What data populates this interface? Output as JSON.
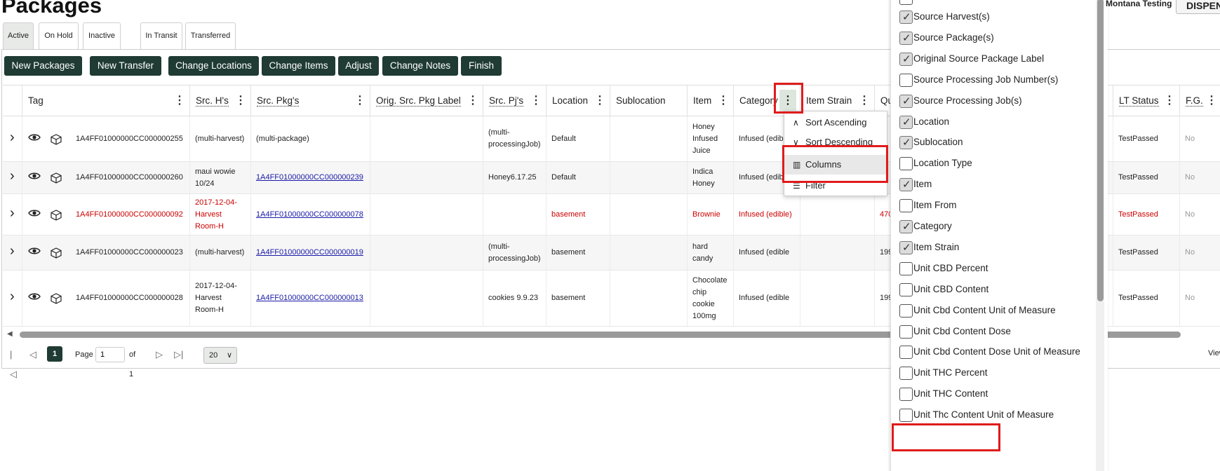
{
  "page": {
    "title": "Packages",
    "facility": "Montana Testing",
    "dispense_label": "DISPENSE"
  },
  "tabs": [
    {
      "label": "Active",
      "active": true
    },
    {
      "label": "On Hold"
    },
    {
      "label": "Inactive"
    },
    {
      "label": "In Transit"
    },
    {
      "label": "Transferred"
    }
  ],
  "toolbar": [
    "New Packages",
    "New Transfer",
    "Change Locations",
    "Change Items",
    "Adjust",
    "Change Notes",
    "Finish"
  ],
  "columns": [
    "Tag",
    "Src. H's",
    "Src. Pkg's",
    "Orig. Src. Pkg Label",
    "Src. Pj's",
    "Location",
    "Sublocation",
    "Item",
    "Category",
    "Item Strain",
    "Qu",
    "LT Status",
    "F.G."
  ],
  "rows": [
    {
      "tag": "1A4FF01000000CC000000255",
      "src_h": [
        "(multi-harvest)"
      ],
      "src_pkg": "(multi-package)",
      "src_pkg_link": false,
      "src_pj": [
        "(multi-",
        "processingJob)"
      ],
      "location": "Default",
      "item": [
        "Honey",
        "Infused",
        "Juice"
      ],
      "category": "Infused (edible",
      "qty": "",
      "lt": "TestPassed",
      "fg": "No",
      "red": false
    },
    {
      "tag": "1A4FF01000000CC000000260",
      "src_h": [
        "maui wowie",
        "10/24"
      ],
      "src_pkg": "1A4FF01000000CC000000239",
      "src_pkg_link": true,
      "src_pj": [
        "Honey6.17.25"
      ],
      "location": "Default",
      "item": [
        "Indica",
        "Honey"
      ],
      "category": "Infused (edib",
      "qty": "",
      "lt": "TestPassed",
      "fg": "No",
      "red": false
    },
    {
      "tag": "1A4FF01000000CC000000092",
      "src_h": [
        "2017-12-04-",
        "Harvest",
        "Room-H"
      ],
      "src_pkg": "1A4FF01000000CC000000078",
      "src_pkg_link": true,
      "src_pj": [],
      "location": "basement",
      "item": [
        "Brownie"
      ],
      "category": "Infused (edible)",
      "qty": "470",
      "lt": "TestPassed",
      "fg": "No",
      "red": true
    },
    {
      "tag": "1A4FF01000000CC000000023",
      "src_h": [
        "(multi-harvest)"
      ],
      "src_pkg": "1A4FF01000000CC000000019",
      "src_pkg_link": true,
      "src_pj": [
        "(multi-",
        "processingJob)"
      ],
      "location": "basement",
      "item": [
        "hard",
        "candy"
      ],
      "category": "Infused (edible",
      "qty": "199",
      "lt": "TestPassed",
      "fg": "No",
      "red": false
    },
    {
      "tag": "1A4FF01000000CC000000028",
      "src_h": [
        "2017-12-04-",
        "Harvest",
        "Room-H"
      ],
      "src_pkg": "1A4FF01000000CC000000013",
      "src_pkg_link": true,
      "src_pj": [
        "cookies 9.9.23"
      ],
      "location": "basement",
      "item": [
        "Chocolate",
        "chip",
        "cookie",
        "100mg"
      ],
      "category": "Infused (edible",
      "qty": "199",
      "lt": "TestPassed",
      "fg": "No",
      "red": false
    }
  ],
  "pager": {
    "current": "1",
    "page_label": "Page",
    "page_value": "1",
    "of_label": "of 1",
    "page_size": "20",
    "view_label": "View"
  },
  "column_menu": [
    "Sort Ascending",
    "Sort Descending",
    "Columns",
    "Filter"
  ],
  "column_options": [
    {
      "label": "Source Harvest(s)",
      "checked": true
    },
    {
      "label": "Source Package(s)",
      "checked": true
    },
    {
      "label": "Original Source Package Label",
      "checked": true
    },
    {
      "label": "Source Processing Job Number(s)",
      "checked": false
    },
    {
      "label": "Source Processing Job(s)",
      "checked": true
    },
    {
      "label": "Location",
      "checked": true
    },
    {
      "label": "Sublocation",
      "checked": true
    },
    {
      "label": "Location Type",
      "checked": false
    },
    {
      "label": "Item",
      "checked": true
    },
    {
      "label": "Item From",
      "checked": false
    },
    {
      "label": "Category",
      "checked": true
    },
    {
      "label": "Item Strain",
      "checked": true
    },
    {
      "label": "Unit CBD Percent",
      "checked": false
    },
    {
      "label": "Unit CBD Content",
      "checked": false
    },
    {
      "label": "Unit Cbd Content Unit of Measure",
      "checked": false
    },
    {
      "label": "Unit Cbd Content Dose",
      "checked": false
    },
    {
      "label": "Unit Cbd Content Dose Unit of Measure",
      "checked": false
    },
    {
      "label": "Unit THC Percent",
      "checked": false
    },
    {
      "label": "Unit THC Content",
      "checked": false
    },
    {
      "label": "Unit Thc Content Unit of Measure",
      "checked": false
    }
  ]
}
